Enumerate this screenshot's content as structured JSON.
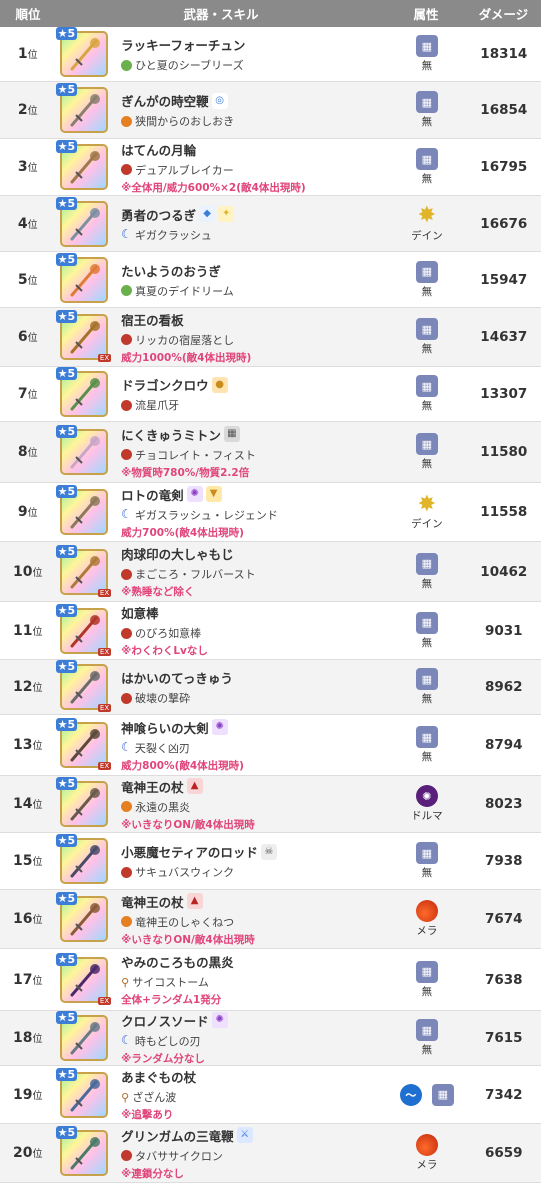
{
  "header": {
    "rank": "順位",
    "weapon": "武器・スキル",
    "attr": "属性",
    "damage": "ダメージ"
  },
  "rank_suffix": "位",
  "star_label": "5",
  "ex_label": "EX",
  "rows": [
    {
      "rank": "1",
      "name": "ラッキーフォーチュン",
      "skill": "ひと夏のシーブリーズ",
      "note": "",
      "attr": "無",
      "damage": "18314"
    },
    {
      "rank": "2",
      "name": "ぎんがの時空鞭",
      "skill": "狭間からのおしおき",
      "note": "",
      "attr": "無",
      "damage": "16854"
    },
    {
      "rank": "3",
      "name": "はてんの月輪",
      "skill": "デュアルブレイカー",
      "note": "※全体用/威力600%×2(敵4体出現時)",
      "attr": "無",
      "damage": "16795"
    },
    {
      "rank": "4",
      "name": "勇者のつるぎ",
      "skill": "ギガクラッシュ",
      "note": "",
      "attr": "デイン",
      "damage": "16676"
    },
    {
      "rank": "5",
      "name": "たいようのおうぎ",
      "skill": "真夏のデイドリーム",
      "note": "",
      "attr": "無",
      "damage": "15947"
    },
    {
      "rank": "6",
      "name": "宿王の看板",
      "skill": "リッカの宿屋落とし",
      "note": "威力1000%(敵4体出現時)",
      "attr": "無",
      "damage": "14637"
    },
    {
      "rank": "7",
      "name": "ドラゴンクロウ",
      "skill": "流星爪牙",
      "note": "",
      "attr": "無",
      "damage": "13307"
    },
    {
      "rank": "8",
      "name": "にくきゅうミトン",
      "skill": "チョコレイト・フィスト",
      "note": "※物質時780%/物質2.2倍",
      "attr": "無",
      "damage": "11580"
    },
    {
      "rank": "9",
      "name": "ロトの竜剣",
      "skill": "ギガスラッシュ・レジェンド",
      "note": "威力700%(敵4体出現時)",
      "attr": "デイン",
      "damage": "11558"
    },
    {
      "rank": "10",
      "name": "肉球印の大しゃもじ",
      "skill": "まごころ・フルバースト",
      "note": "※熟睡など除く",
      "attr": "無",
      "damage": "10462"
    },
    {
      "rank": "11",
      "name": "如意棒",
      "skill": "のびろ如意棒",
      "note": "※わくわくLvなし",
      "attr": "無",
      "damage": "9031"
    },
    {
      "rank": "12",
      "name": "はかいのてっきゅう",
      "skill": "破壊の撃砕",
      "note": "",
      "attr": "無",
      "damage": "8962"
    },
    {
      "rank": "13",
      "name": "神喰らいの大剣",
      "skill": "天裂く凶刃",
      "note": "威力800%(敵4体出現時)",
      "attr": "無",
      "damage": "8794"
    },
    {
      "rank": "14",
      "name": "竜神王の杖",
      "skill": "永遠の黒炎",
      "note": "※いきなりON/敵4体出現時",
      "attr": "ドルマ",
      "damage": "8023"
    },
    {
      "rank": "15",
      "name": "小悪魔セティアのロッド",
      "skill": "サキュバスウィンク",
      "note": "",
      "attr": "無",
      "damage": "7938"
    },
    {
      "rank": "16",
      "name": "竜神王の杖",
      "skill": "竜神王のしゃくねつ",
      "note": "※いきなりON/敵4体出現時",
      "attr": "メラ",
      "damage": "7674"
    },
    {
      "rank": "17",
      "name": "やみのころもの黒炎",
      "skill": "サイコストーム",
      "note": "全体+ランダム1発分",
      "attr": "無",
      "damage": "7638"
    },
    {
      "rank": "18",
      "name": "クロノスソード",
      "skill": "時もどしの刃",
      "note": "※ランダム分なし",
      "attr": "無",
      "damage": "7615"
    },
    {
      "rank": "19",
      "name": "あまぐもの杖",
      "skill": "ざざん波",
      "note": "※追撃あり",
      "attr": "",
      "damage": "7342"
    },
    {
      "rank": "20",
      "name": "グリンガムの三竜鞭",
      "skill": "タバササイクロン",
      "note": "※連鎖分なし",
      "attr": "メラ",
      "damage": "6659"
    }
  ],
  "icons": {
    "mu": "mu-attribute-icon",
    "dein": "dein-attribute-icon",
    "dolma": "dolma-attribute-icon",
    "mera": "mera-attribute-icon",
    "wave": "water-attribute-icon"
  },
  "colors": {
    "header_bg": "#8a8a8a",
    "note": "#e0457b",
    "mu": "#7b86b9"
  }
}
